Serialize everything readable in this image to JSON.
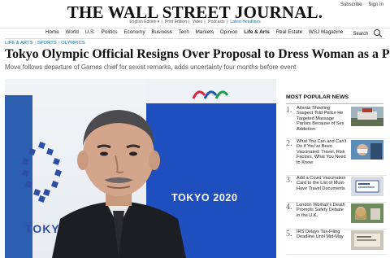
{
  "masthead": {
    "title": "THE WALL STREET JOURNAL."
  },
  "account": {
    "subscribe": "Subscribe",
    "signin": "Sign In"
  },
  "editions": {
    "english": "English Edition ▾",
    "print": "Print Edition",
    "video": "Video",
    "podcasts": "Podcasts",
    "latest": "Latest Headlines"
  },
  "nav": {
    "items": [
      "Home",
      "World",
      "U.S.",
      "Politics",
      "Economy",
      "Business",
      "Tech",
      "Markets",
      "Opinion",
      "Life & Arts",
      "Real Estate",
      "WSJ Magazine"
    ],
    "active": "Life & Arts",
    "search_label": "Search"
  },
  "breadcrumbs": [
    "LIFE & ARTS",
    "SPORTS",
    "OLYMPICS"
  ],
  "article": {
    "headline": "Tokyo Olympic Official Resigns Over Proposal to Dress Woman as a Pig",
    "dek": "Move follows departure of Games chief for sexist remarks, adds uncertainty four months before event"
  },
  "photo": {
    "backdrop_text_right": "TOKYO 2020",
    "backdrop_text_left": "TOKY"
  },
  "most_popular": {
    "title": "MOST POPULAR NEWS",
    "items": [
      {
        "num": "1.",
        "text": "Atlanta Shooting Suspect Told Police He Targeted Massage Parlors Because of Sex Addiction"
      },
      {
        "num": "2.",
        "text": "What You Can and Can't Do if You've Been Vaccinated: Travel, Risk Factors, What You Need to Know"
      },
      {
        "num": "3.",
        "text": "Add a Covid Vaccination Card to the List of Must-Have Travel Documents"
      },
      {
        "num": "4.",
        "text": "London Woman's Death Prompts Safety Debate in the U.K."
      },
      {
        "num": "5.",
        "text": "IRS Delays Tax-Filing Deadline Until Mid-May"
      }
    ]
  },
  "colors": {
    "link_blue": "#0274b6",
    "backdrop_blue": "#1f4fbf"
  }
}
